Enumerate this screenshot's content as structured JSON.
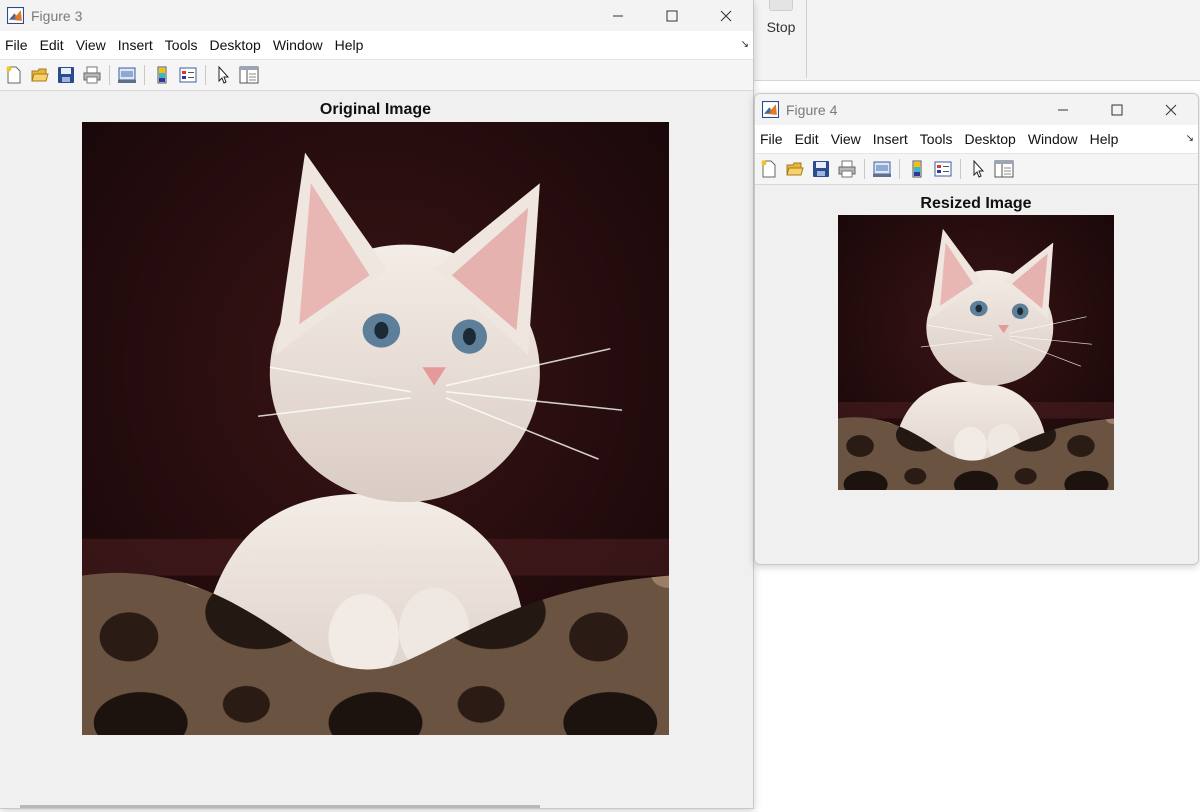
{
  "background_app": {
    "stop_label": "Stop"
  },
  "figures": [
    {
      "title": "Figure 3",
      "menu": [
        "File",
        "Edit",
        "View",
        "Insert",
        "Tools",
        "Desktop",
        "Window",
        "Help"
      ],
      "axes_title": "Original Image"
    },
    {
      "title": "Figure 4",
      "menu": [
        "File",
        "Edit",
        "View",
        "Insert",
        "Tools",
        "Desktop",
        "Window",
        "Help"
      ],
      "axes_title": "Resized Image"
    }
  ],
  "toolbar_icons": [
    "new-figure-icon",
    "open-file-icon",
    "save-icon",
    "print-icon",
    "link-plot-icon",
    "insert-colorbar-icon",
    "insert-legend-icon",
    "edit-plot-icon",
    "property-inspector-icon"
  ],
  "image_content": "kitten",
  "colors": {
    "window_bg": "#f0f0f0",
    "titlebar_bg": "#f3f3f3",
    "menubar_bg": "#ffffff",
    "matlab_orange": "#e0772a",
    "matlab_blue": "#2a4b8d"
  }
}
